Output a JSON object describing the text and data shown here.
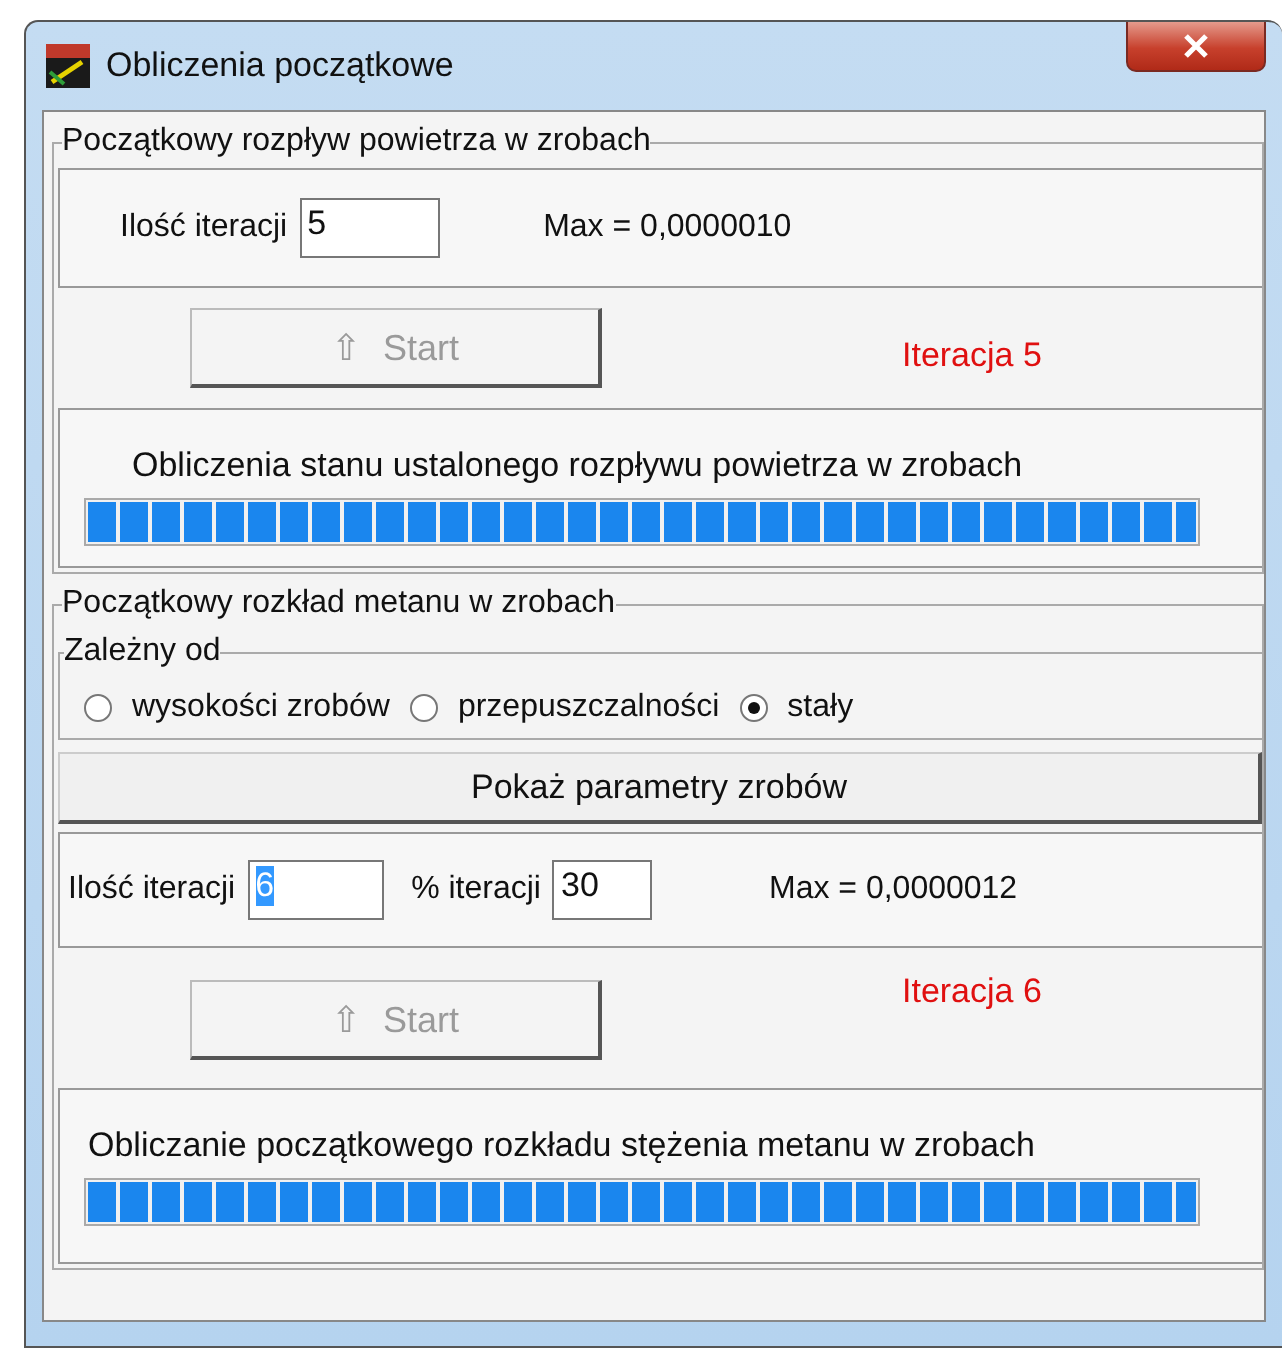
{
  "window": {
    "title": "Obliczenia początkowe"
  },
  "air_group": {
    "legend": "Początkowy rozpływ powietrza w zrobach",
    "iterations_label": "Ilość iteracji",
    "iterations_value": "5",
    "iterations_highlighted": false,
    "max": "Max = 0,0000010",
    "start_button": {
      "icon": "⇧",
      "label": "Start",
      "disabled": true
    },
    "iteration_status": "Iteracja 5",
    "progress": {
      "caption": "Obliczenia stanu ustalonego rozpływu powietrza w zrobach",
      "level": 1
    }
  },
  "methane_group": {
    "legend": "Początkowy rozkład metanu w zrobach",
    "depends_legend": "Zależny od",
    "options": [
      {
        "label": "wysokości zrobów",
        "selected": false
      },
      {
        "label": "przepuszczalności",
        "selected": false
      },
      {
        "label": "stały",
        "selected": true
      }
    ],
    "params_button": "Pokaż parametry zrobów",
    "iterations_label": "Ilość iteracji",
    "iterations_value": "6",
    "iterations_highlighted": true,
    "percent_label": "% iteracji",
    "percent_value": "30",
    "max": "Max = 0,0000012",
    "start_button": {
      "icon": "⇧",
      "label": "Start",
      "disabled": true
    },
    "iteration_status": "Iteracja 6",
    "progress": {
      "caption": "Obliczanie początkowego rozkładu stężenia metanu w zrobach",
      "level": 1
    }
  }
}
